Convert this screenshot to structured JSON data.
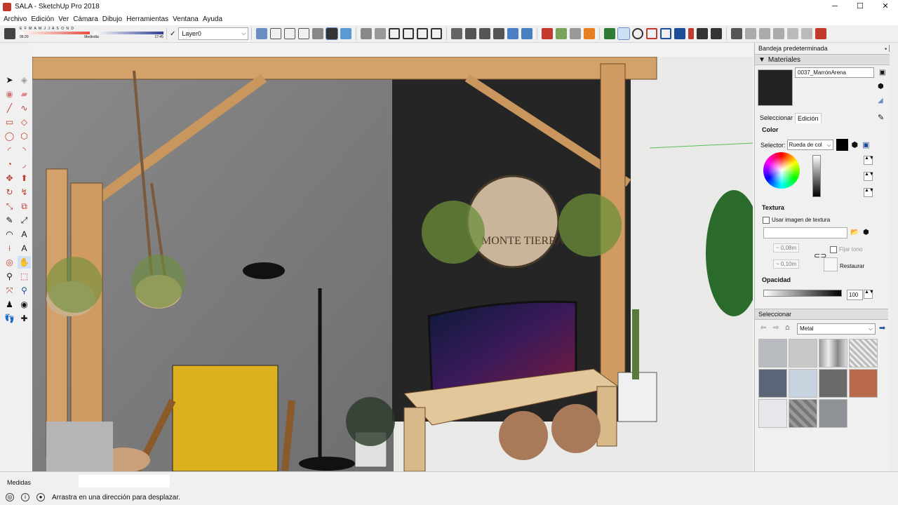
{
  "window": {
    "title": "SALA - SketchUp Pro 2018",
    "minimize": "─",
    "maximize": "☐",
    "close": "✕"
  },
  "menu": [
    "Archivo",
    "Edición",
    "Ver",
    "Cámara",
    "Dibujo",
    "Herramientas",
    "Ventana",
    "Ayuda"
  ],
  "shadows": {
    "months": "E F M A M J J A S O N D",
    "time_start": "06:20",
    "time_mid": "Mediodía",
    "time_end": "17:45"
  },
  "layer": {
    "value": "Layer0",
    "check": "✓"
  },
  "tray": {
    "title": "Bandeja predeterminada",
    "section": "Materiales",
    "material_name": "0037_MarrónArena",
    "tab_select": "Seleccionar",
    "tab_edit": "Edición",
    "color_label": "Color",
    "selector_label": "Selector:",
    "selector_value": "Rueda de col",
    "texture_label": "Textura",
    "use_texture": "Usar imagen de textura",
    "width_value": "~ 0,08m",
    "height_value": "~ 0,10m",
    "fix_hue": "Fijar tono",
    "restore": "Restaurar",
    "opacity_label": "Opacidad",
    "opacity_value": "100",
    "select_bar": "Seleccionar",
    "library": "Metal"
  },
  "status": {
    "measure_label": "Medidas",
    "hint": "Arrastra en una dirección para desplazar."
  },
  "colors": {
    "material_swatch": "#222222",
    "selected_color": "#000000"
  },
  "tools_icons": [
    "select-icon",
    "eraser-icon",
    "paint-icon",
    "line-icon",
    "rectangle-icon",
    "circle-icon",
    "arc-icon",
    "move-icon",
    "rotate-icon",
    "offset-icon",
    "tape-icon",
    "text-icon",
    "axes-icon",
    "orbit-icon",
    "pan-icon",
    "zoom-icon",
    "zoom-extents-icon",
    "walk-icon"
  ]
}
